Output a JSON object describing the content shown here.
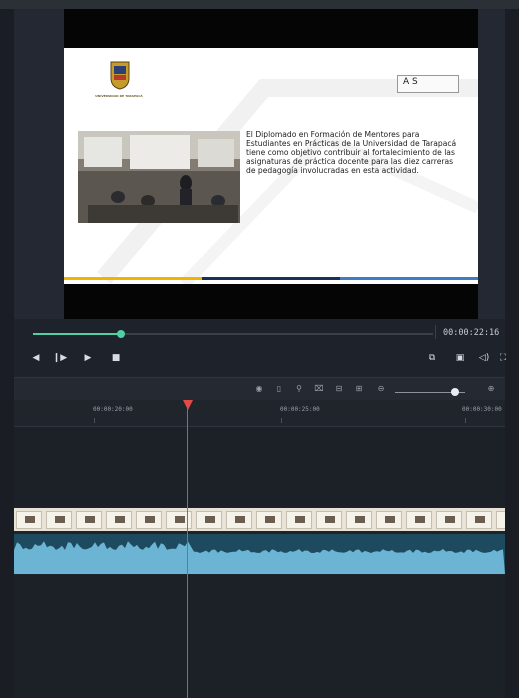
{
  "player": {
    "timecode": "00:00:22:16",
    "progress_fraction": 0.22
  },
  "slide": {
    "crest_caption": "UNIVERSIDAD DE TARAPACÁ",
    "as_logo": "A S",
    "body_text": "El Diplomado en Formación de Mentores para Estudiantes en Prácticas de la Universidad de Tarapacá tiene como objetivo contribuir al fortalecimiento de las asignaturas de práctica docente para las diez carreras de pedagogía involucradas en esta actividad.",
    "stripe_colors": [
      "#f0b400",
      "#1c2f57",
      "#3d7cc9"
    ]
  },
  "controls": {
    "icons": [
      "prev-frame-icon",
      "step-forward-icon",
      "play-icon",
      "stop-icon",
      "snapshot-icon",
      "fullscreen-fit-icon",
      "volume-icon",
      "expand-icon"
    ]
  },
  "timeline": {
    "toolbar_icons": [
      "split-icon",
      "delete-icon",
      "marker-icon",
      "crop-icon",
      "freeze-frame-icon",
      "zoom-out-icon",
      "zoom-in-icon"
    ],
    "zoom_level_fraction": 0.8,
    "ruler_labels": [
      "00:00:20:00",
      "00:00:25:00",
      "00:00:30:00"
    ],
    "accent_color": "#4fd1a5",
    "playhead_color": "#e24a4a"
  }
}
